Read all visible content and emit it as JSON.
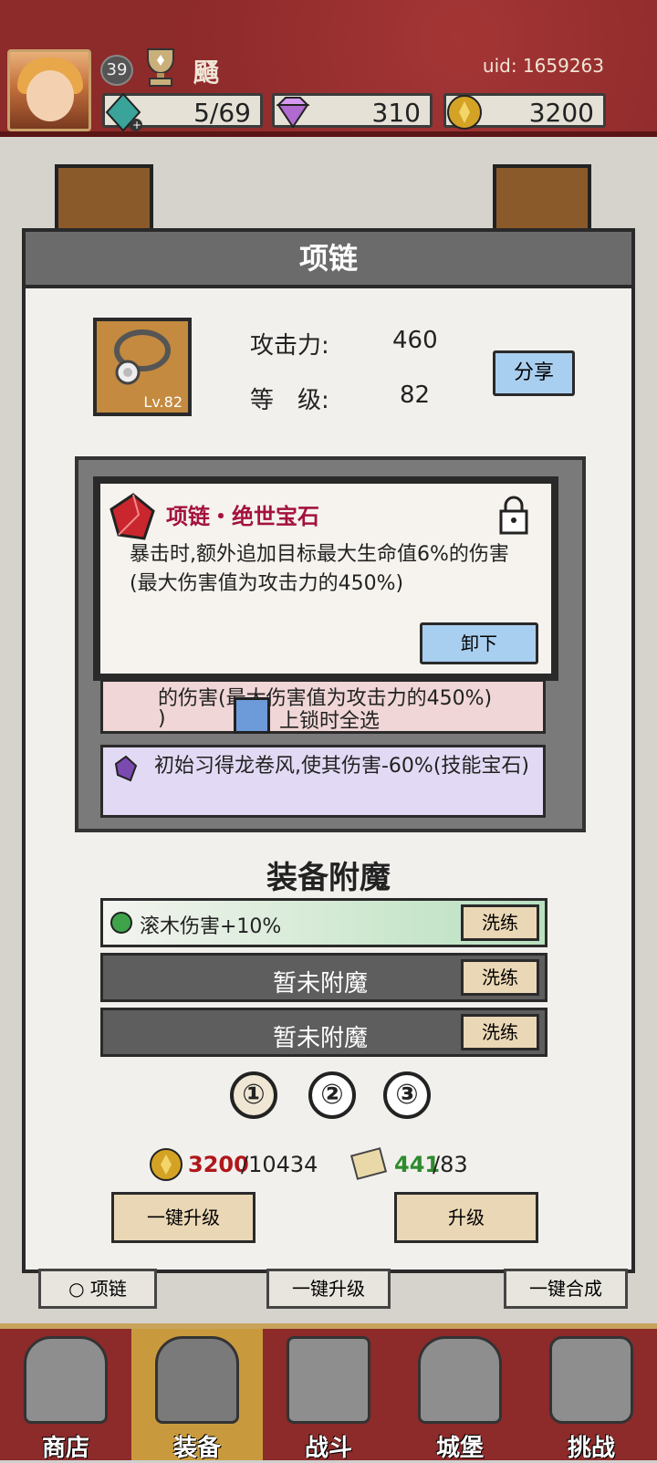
{
  "header": {
    "player_level": "39",
    "player_name": "颾",
    "uid": "uid: 1659263",
    "energy": "5/69",
    "gems": "310",
    "coins": "3200"
  },
  "popup": {
    "title": "项链",
    "stat_attack_label": "攻击力:",
    "stat_attack_value": "460",
    "stat_level_label": "等　级:",
    "stat_level_value": "82",
    "item_level": "Lv.82",
    "share_label": "分享"
  },
  "gem_tooltip": {
    "title": "项链・绝世宝石",
    "description": "暴击时,额外追加目标最大生命值6%的伤害(最大伤害值为攻击力的450%)",
    "unequip_label": "卸下"
  },
  "gem_rows": {
    "row1_text": "的伤害(最大伤害值为攻击力的450%)",
    "row1_tail": ")",
    "lock_select_label": "上锁时全选",
    "row2_text": "初始习得龙卷风,使其伤害-60%(技能宝石)"
  },
  "enchant": {
    "title": "装备附魔",
    "slots": [
      {
        "text": "滚木伤害+10%",
        "button": "洗练"
      },
      {
        "text": "暂未附魔",
        "button": "洗练"
      },
      {
        "text": "暂未附魔",
        "button": "洗练"
      }
    ],
    "tabs": [
      "①",
      "②",
      "③"
    ]
  },
  "costs": {
    "coin_have": "3200",
    "coin_need": "/10434",
    "scroll_have": "441",
    "scroll_need": "/83"
  },
  "actions": {
    "upgrade_all": "一键升级",
    "upgrade": "升级"
  },
  "under_buttons": {
    "necklace": "项链",
    "upgrade_all": "一键升级",
    "merge_all": "一键合成"
  },
  "nav": [
    "商店",
    "装备",
    "战斗",
    "城堡",
    "挑战"
  ],
  "colors": {
    "header_red": "#8d2a2a",
    "accent_blue": "#a9cff0",
    "title_crimson": "#a3123d",
    "cost_red": "#b0161b",
    "cost_green": "#2e8b2e"
  },
  "icons": [
    "gem-energy-icon",
    "diamond-icon",
    "coin-icon",
    "trophy-icon",
    "necklace-icon",
    "ruby-gem-icon",
    "padlock-icon",
    "amethyst-gem-icon",
    "emerald-icon",
    "scroll-icon"
  ]
}
